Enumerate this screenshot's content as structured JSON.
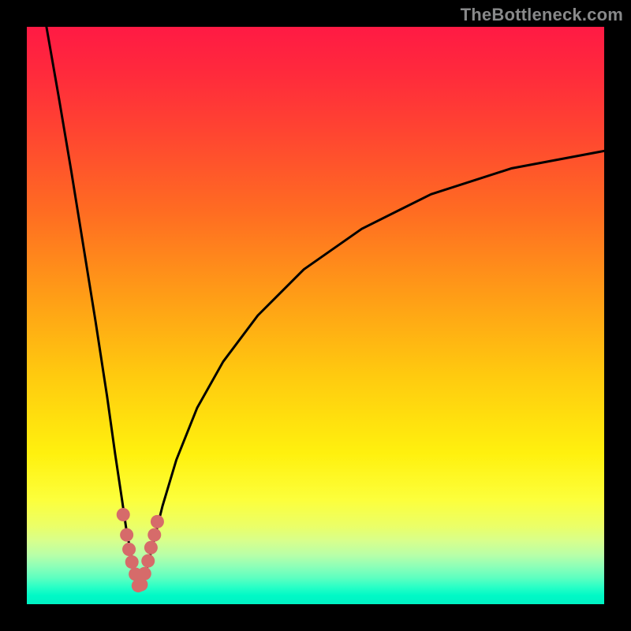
{
  "watermark": "TheBottleneck.com",
  "colors": {
    "background_outer": "#000000",
    "gradient_top": "#ff1a44",
    "gradient_bottom": "#00f2c4",
    "curve_stroke": "#000000",
    "marker_fill": "#d66b6a"
  },
  "chart_data": {
    "type": "line",
    "title": "",
    "xlabel": "",
    "ylabel": "",
    "xlim": [
      0,
      100
    ],
    "ylim": [
      0,
      100
    ],
    "note": "Axis ranges inferred (no tick labels visible). Bottleneck-style curve: two branches descending to a sharp minimum near x≈19.5; left branch starts at top-left corner, right branch rises to upper right and exits right edge around y≈78. Values below are sampled (x, y) points along the visible curve, with markers clustered near the minimum.",
    "series": [
      {
        "name": "curve",
        "x": [
          3.4,
          5.5,
          7.7,
          9.8,
          11.9,
          13.9,
          15.3,
          16.5,
          17.3,
          18.2,
          19.0,
          19.5,
          20.2,
          21.0,
          22.0,
          23.5,
          25.9,
          29.5,
          34.0,
          40.0,
          48.0,
          58.0,
          70.0,
          84.0,
          100.0
        ],
        "y": [
          100.0,
          88.0,
          75.0,
          62.0,
          49.0,
          36.0,
          26.0,
          18.0,
          12.5,
          8.0,
          4.5,
          2.5,
          4.2,
          7.0,
          11.0,
          17.0,
          25.0,
          34.0,
          42.0,
          50.0,
          58.0,
          65.0,
          71.0,
          75.5,
          78.5
        ],
        "values": null
      }
    ],
    "markers": {
      "name": "highlighted-points",
      "x": [
        16.7,
        17.3,
        17.7,
        18.2,
        18.8,
        19.3,
        19.8,
        20.4,
        21.0,
        21.5,
        22.1,
        22.6
      ],
      "y": [
        15.5,
        12.0,
        9.5,
        7.3,
        5.2,
        3.2,
        3.4,
        5.3,
        7.5,
        9.8,
        12.0,
        14.3
      ]
    }
  }
}
